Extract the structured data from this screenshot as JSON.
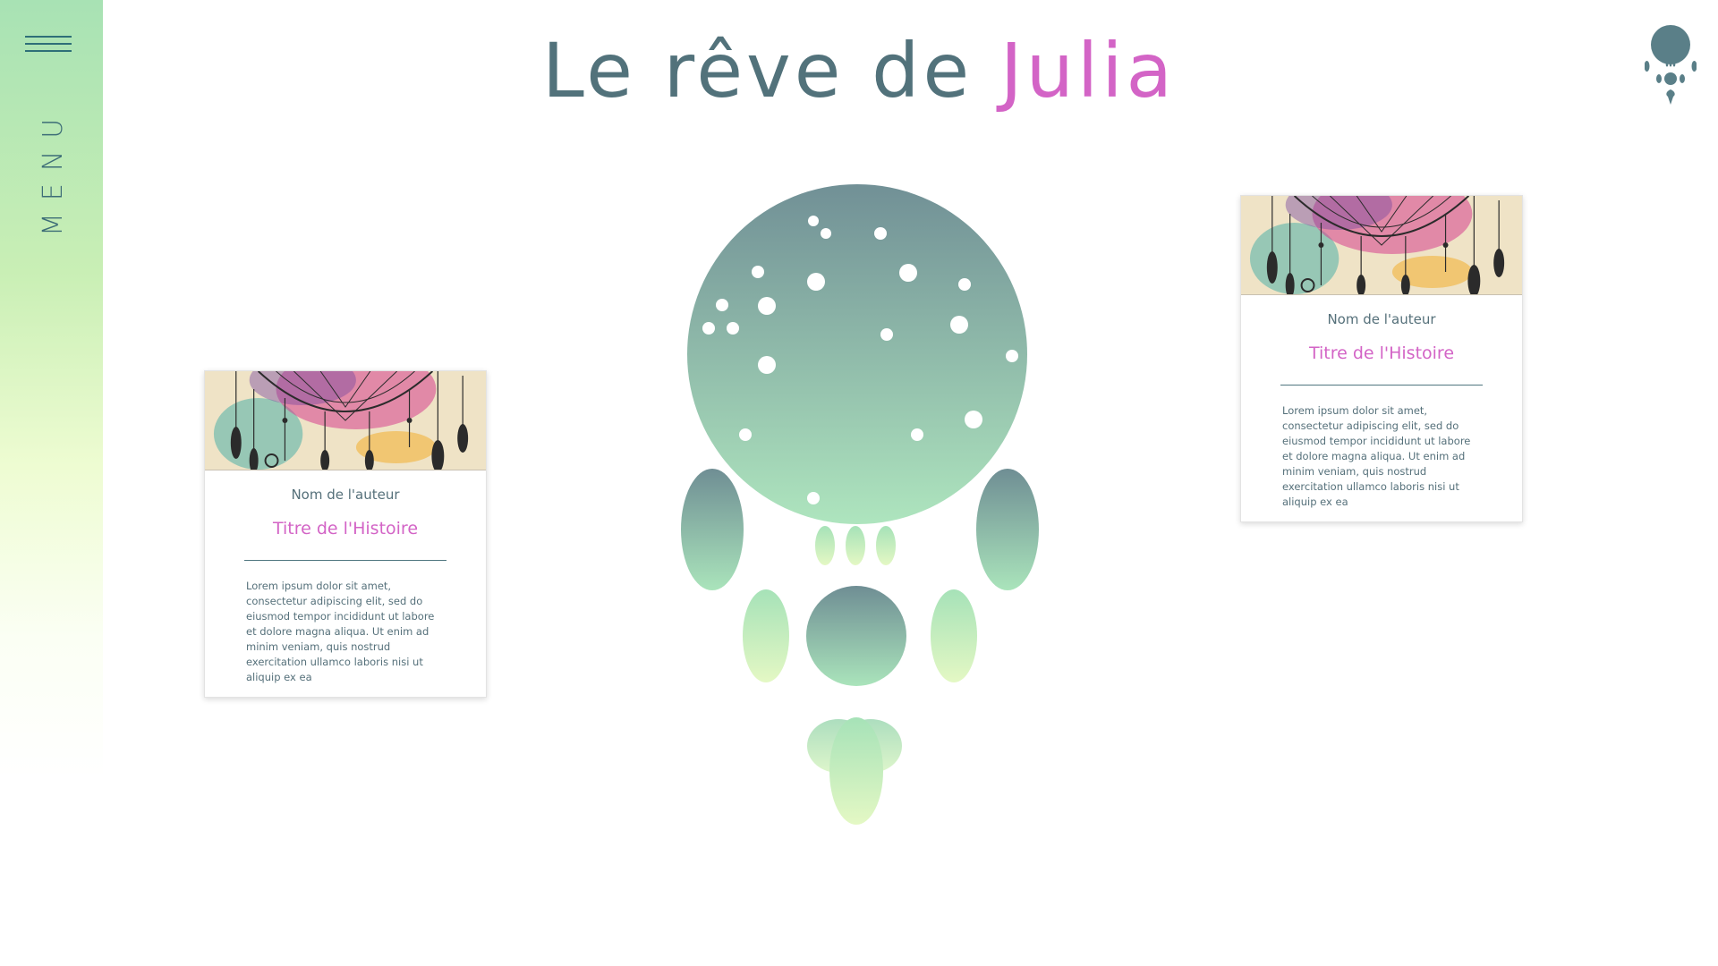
{
  "sidebar": {
    "menu_label": "MENU",
    "hamburger_icon": "hamburger-menu-icon",
    "gradient_top": "#a8e2b4",
    "gradient_bottom": "#ffffff"
  },
  "header": {
    "title_main": "Le rêve de ",
    "title_accent": "Julia",
    "title_color": "#52727b",
    "accent_color": "#d364c6",
    "logo_icon": "dreamcatcher-logo-icon"
  },
  "main": {
    "illustration_icon": "dreamcatcher-illustration",
    "cards": [
      {
        "image_icon": "dreamcatcher-watercolor-image",
        "author": "Nom de l'auteur",
        "title": "Titre de l'Histoire",
        "excerpt": "Lorem ipsum dolor sit amet, consectetur adipiscing elit, sed do eiusmod tempor incididunt ut labore et dolore magna aliqua. Ut enim ad minim veniam, quis nostrud exercitation ullamco laboris nisi ut aliquip ex ea"
      },
      {
        "image_icon": "dreamcatcher-watercolor-image",
        "author": "Nom de l'auteur",
        "title": "Titre de l'Histoire",
        "excerpt": "Lorem ipsum dolor sit amet, consectetur adipiscing elit, sed do eiusmod tempor incididunt ut labore et dolore magna aliqua. Ut enim ad minim veniam, quis nostrud exercitation ullamco laboris nisi ut aliquip ex ea"
      }
    ]
  }
}
